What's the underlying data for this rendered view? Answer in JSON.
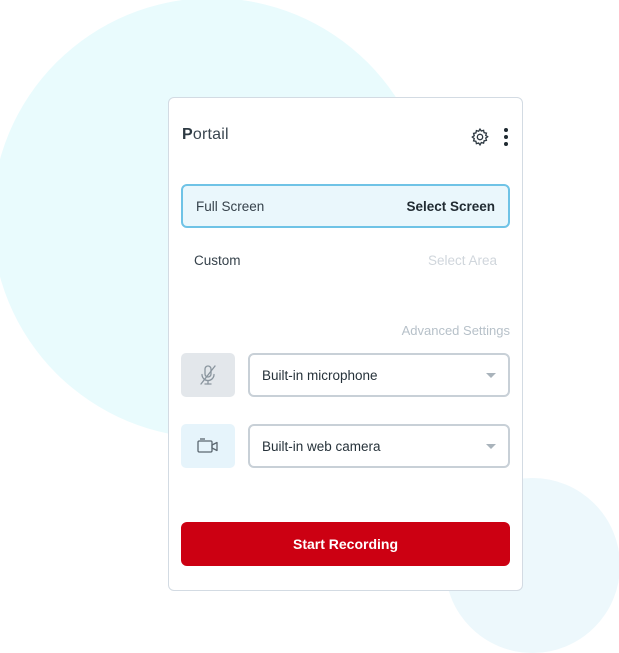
{
  "app": {
    "title_initial": "P",
    "title_rest": "ortail"
  },
  "icons": {
    "settings": "gear-icon",
    "more": "more-vertical-icon",
    "microphone": "microphone-muted-icon",
    "camera": "camera-icon"
  },
  "capture_options": [
    {
      "label": "Full Screen",
      "action": "Select Screen",
      "selected": true
    },
    {
      "label": "Custom",
      "action": "Select Area",
      "selected": false
    }
  ],
  "advanced_settings_label": "Advanced Settings",
  "microphone": {
    "selected": "Built-in microphone",
    "muted": true
  },
  "camera": {
    "selected": "Built-in web camera"
  },
  "start_button_label": "Start Recording",
  "colors": {
    "accent": "#cc0012",
    "selected_border": "#6fc3e6",
    "background_circle": "#e9fbfd"
  }
}
